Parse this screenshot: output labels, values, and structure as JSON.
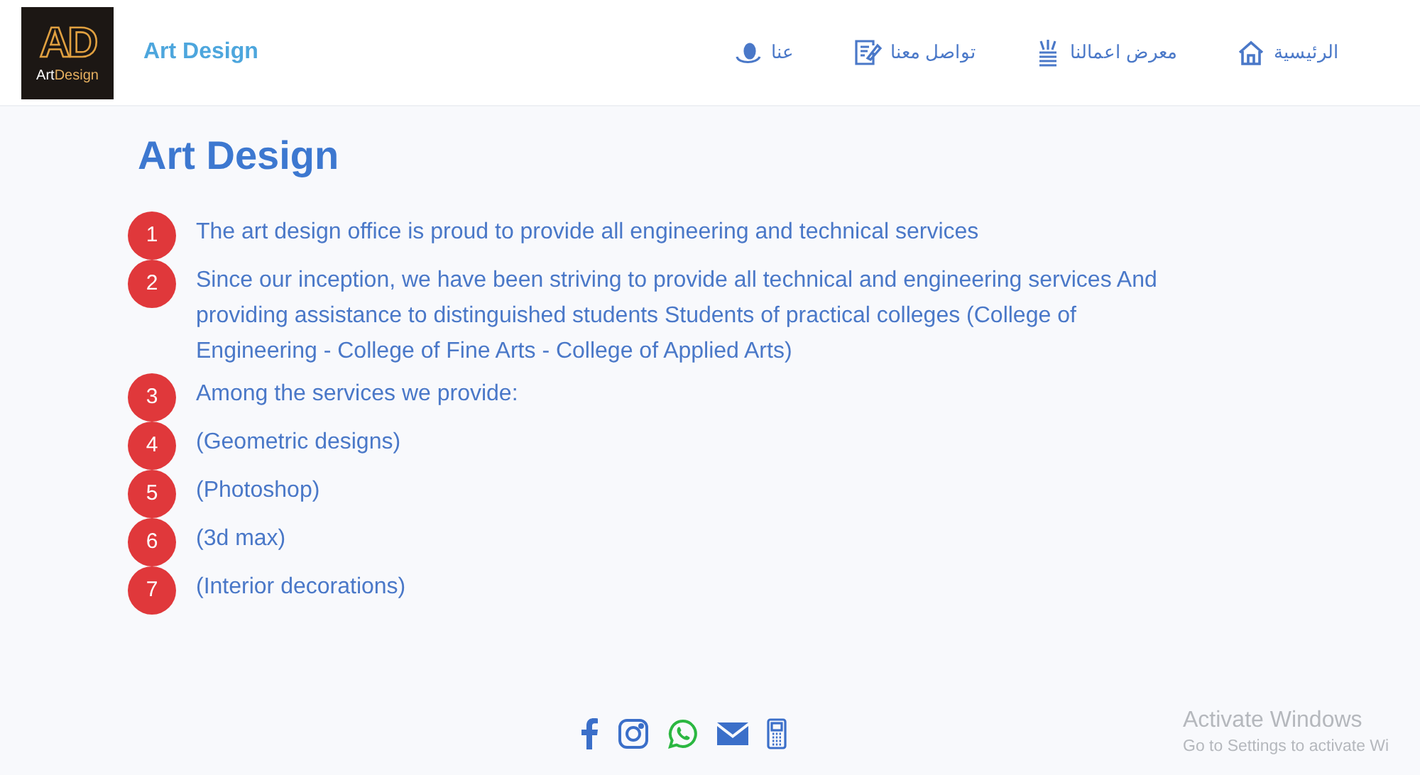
{
  "logo": {
    "monogram": "AD",
    "wordmark_1": "Art",
    "wordmark_2": "Design"
  },
  "brand": "Art Design",
  "nav": [
    {
      "label": "الرئيسية"
    },
    {
      "label": "معرض اعمالنا"
    },
    {
      "label": "تواصل معنا"
    },
    {
      "label": "عنا"
    }
  ],
  "heading": "Art Design",
  "items": [
    {
      "number": "1",
      "text": "The art design office is proud to provide all engineering and technical services"
    },
    {
      "number": "2",
      "text": "Since our inception, we have been striving to provide all technical and engineering services And providing assistance to distinguished students Students of practical colleges (College of Engineering - College of Fine Arts - College of Applied Arts)"
    },
    {
      "number": "3",
      "text": "Among the services we provide:"
    },
    {
      "number": "4",
      "text": "(Geometric designs)"
    },
    {
      "number": "5",
      "text": "(Photoshop)"
    },
    {
      "number": "6",
      "text": "(3d max)"
    },
    {
      "number": "7",
      "text": "(Interior decorations)"
    }
  ],
  "activation": {
    "title": "Activate Windows",
    "message": "Go to Settings to activate Wi"
  }
}
